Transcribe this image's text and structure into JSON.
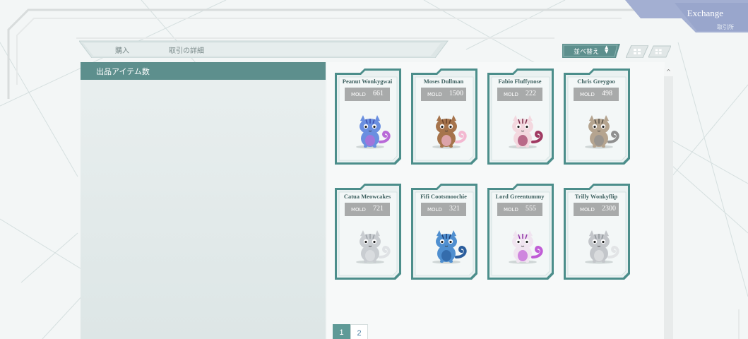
{
  "exchange": {
    "title": "Exchange",
    "subtitle": "取引所"
  },
  "tabs": [
    {
      "label": "購入"
    },
    {
      "label": "取引の詳細"
    }
  ],
  "sort": {
    "label": "並べ替え",
    "arrows": "▲▼"
  },
  "left_panel": {
    "header": "出品アイテム数"
  },
  "scroll": {
    "up_glyph": "^"
  },
  "colors": {
    "teal": "#5d8f8d",
    "card_border": "#4c8e8b",
    "price_bg": "#a8aaaa",
    "badge": "#a3afd2"
  },
  "cards": [
    {
      "name": "Peanut Wonkygwai",
      "currency": "MOLD",
      "price": "661",
      "cat": "blue-cat-icon"
    },
    {
      "name": "Moses Dullman",
      "currency": "MOLD",
      "price": "1500",
      "cat": "brown-winged-cat-icon"
    },
    {
      "name": "Fabio Fluffynose",
      "currency": "MOLD",
      "price": "222",
      "cat": "pink-cat-icon"
    },
    {
      "name": "Chris Greygoo",
      "currency": "MOLD",
      "price": "498",
      "cat": "grey-tabby-cat-icon"
    },
    {
      "name": "Catua Meowcakes",
      "currency": "MOLD",
      "price": "721",
      "cat": "grey-cat-icon"
    },
    {
      "name": "Fifi Cootsmoochie",
      "currency": "MOLD",
      "price": "321",
      "cat": "blue-spotted-cat-icon"
    },
    {
      "name": "Lord Greentummy",
      "currency": "MOLD",
      "price": "555",
      "cat": "purple-spotted-cat-icon"
    },
    {
      "name": "Trilly Wonkyflip",
      "currency": "MOLD",
      "price": "2300",
      "cat": "silver-cat-icon"
    }
  ],
  "pagination": {
    "pages": [
      "1",
      "2"
    ],
    "current": "1"
  }
}
